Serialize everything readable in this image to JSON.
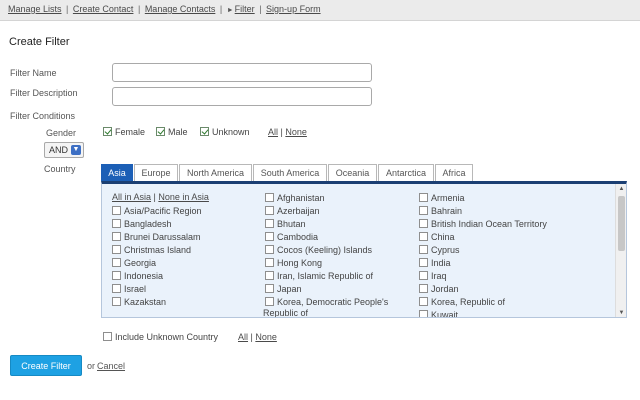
{
  "nav": {
    "manage_lists": "Manage Lists",
    "create_contact": "Create Contact",
    "manage_contacts": "Manage Contacts",
    "filter": "Filter",
    "signup_form": "Sign-up Form",
    "separator": "|"
  },
  "page_title": "Create Filter",
  "form": {
    "filter_name_label": "Filter Name",
    "filter_name_value": "",
    "filter_description_label": "Filter Description",
    "filter_description_value": "",
    "filter_conditions_label": "Filter Conditions",
    "gender_label": "Gender",
    "gender_options": [
      {
        "label": "Female",
        "checked": true
      },
      {
        "label": "Male",
        "checked": true
      },
      {
        "label": "Unknown",
        "checked": true
      }
    ],
    "all_label": "All",
    "none_label": "None",
    "operator_value": "AND",
    "country_label": "Country"
  },
  "tabs": [
    "Asia",
    "Europe",
    "North America",
    "South America",
    "Oceania",
    "Antarctica",
    "Africa"
  ],
  "active_tab": "Asia",
  "panel": {
    "all_in_asia": "All in Asia",
    "none_in_asia": "None in Asia",
    "col1": [
      "Asia/Pacific Region",
      "Bangladesh",
      "Brunei Darussalam",
      "Christmas Island",
      "Georgia",
      "Indonesia",
      "Israel",
      "Kazakstan"
    ],
    "col2": [
      "Afghanistan",
      "Azerbaijan",
      "Bhutan",
      "Cambodia",
      "Cocos (Keeling) Islands",
      "Hong Kong",
      "Iran, Islamic Republic of",
      "Japan"
    ],
    "col2_last_line1": "Korea, Democratic People's",
    "col2_last_line2": "Republic of",
    "col3": [
      "Armenia",
      "Bahrain",
      "British Indian Ocean Territory",
      "China",
      "Cyprus",
      "India",
      "Iraq",
      "Jordan",
      "Korea, Republic of",
      "Kuwait"
    ]
  },
  "include_unknown_label": "Include Unknown Country",
  "actions": {
    "create_filter": "Create Filter",
    "or": "or",
    "cancel": "Cancel"
  },
  "colors": {
    "active_tab": "#1c5fb6",
    "panel_bg": "#eaf2fb",
    "button": "#1ea1e3"
  }
}
